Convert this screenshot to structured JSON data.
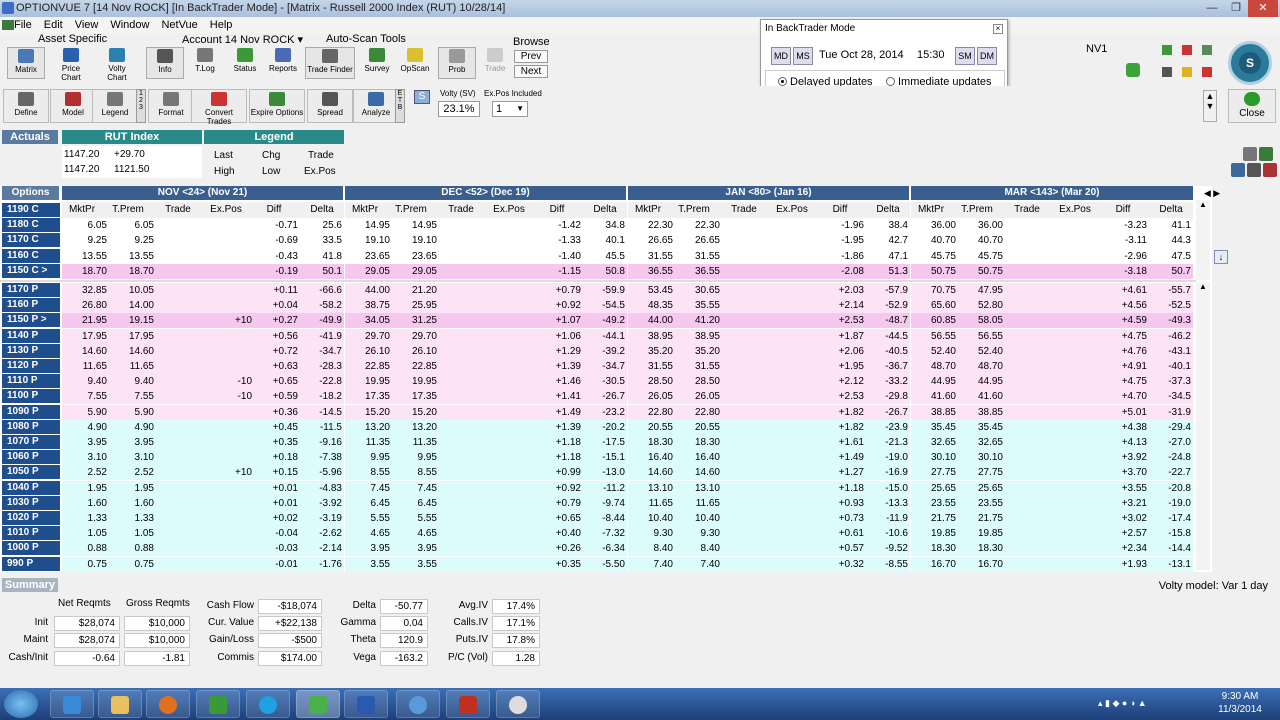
{
  "titlebar": {
    "title": "OPTIONVUE 7   [14 Nov ROCK]   [In BackTrader Mode]  - [Matrix  - Russell 2000 Index (RUT)  10/28/14]",
    "minimize": "—",
    "restore": "❐",
    "close": "✕"
  },
  "menu": [
    "File",
    "Edit",
    "View",
    "Window",
    "NetVue",
    "Help"
  ],
  "ribbon1": {
    "groups": {
      "asset": "Asset Specific",
      "account": "Account 14 Nov ROCK ▾",
      "autoscan": "Auto-Scan Tools",
      "browse": "Browse"
    },
    "buttons": [
      {
        "label": "Matrix",
        "icon": "matrix-icon"
      },
      {
        "label": "Price Chart",
        "icon": "price-chart-icon"
      },
      {
        "label": "Volty Chart",
        "icon": "volty-chart-icon"
      },
      {
        "label": "Info",
        "icon": "info-icon"
      },
      {
        "label": "T.Log",
        "icon": "tlog-icon"
      },
      {
        "label": "Status",
        "icon": "status-icon"
      },
      {
        "label": "Reports",
        "icon": "reports-icon"
      },
      {
        "label": "Trade Finder",
        "icon": "trade-finder-icon"
      },
      {
        "label": "Survey",
        "icon": "survey-icon"
      },
      {
        "label": "OpScan",
        "icon": "opscan-icon"
      },
      {
        "label": "Prob",
        "icon": "prob-icon"
      },
      {
        "label": "Trade",
        "icon": "trade-icon"
      }
    ],
    "prev": "Prev",
    "next": "Next",
    "nv": "NV1"
  },
  "backtrader": {
    "title": "In BackTrader Mode",
    "date": "Tue Oct 28, 2014",
    "time": "15:30",
    "btn_md": "MD",
    "btn_ms": "MS",
    "btn_sm": "SM",
    "btn_dm": "DM",
    "delayed": "Delayed updates",
    "immediate": "Immediate updates"
  },
  "ribbon2": {
    "buttons": [
      "Define",
      "Model",
      "Legend",
      "Format",
      "Convert Trades",
      "Expire Options",
      "Spread",
      "Analyze"
    ],
    "s_btn": "S",
    "volty_label": "Volty (SV)",
    "volty_value": "23.1%",
    "expos_label": "Ex.Pos Included",
    "expos_value": "1",
    "close": "Close"
  },
  "actuals": {
    "label": "Actuals",
    "index_title": "RUT Index",
    "last": "1147.20",
    "chg": "+29.70",
    "high": "1147.20",
    "low": "1121.50",
    "legend_title": "Legend",
    "legend": [
      "Last",
      "Chg",
      "Trade",
      "High",
      "Low",
      "Ex.Pos"
    ]
  },
  "options": {
    "label": "Options",
    "months": [
      "NOV <24> (Nov 21)",
      "DEC <52> (Dec 19)",
      "JAN <80> (Jan 16)",
      "MAR <143> (Mar 20)"
    ],
    "cols": [
      "MktPr",
      "T.Prem",
      "Trade",
      "Ex.Pos",
      "Diff",
      "Delta"
    ],
    "calls": [
      {
        "s": "1190 C",
        "c": "",
        "m": [
          [
            "",
            "",
            "",
            "",
            "",
            ""
          ],
          [
            "",
            "",
            "",
            "",
            "",
            ""
          ],
          [
            "",
            "",
            "",
            "",
            "",
            ""
          ],
          [
            "",
            "",
            "",
            "",
            "",
            ""
          ]
        ]
      },
      {
        "s": "1180 C",
        "c": "",
        "m": [
          [
            "6.05",
            "6.05",
            "",
            "",
            "-0.71",
            "25.6"
          ],
          [
            "14.95",
            "14.95",
            "",
            "",
            "-1.42",
            "34.8"
          ],
          [
            "22.30",
            "22.30",
            "",
            "",
            "-1.96",
            "38.4"
          ],
          [
            "36.00",
            "36.00",
            "",
            "",
            "-3.23",
            "41.1"
          ]
        ]
      },
      {
        "s": "1170 C",
        "c": "",
        "m": [
          [
            "9.25",
            "9.25",
            "",
            "",
            "-0.69",
            "33.5"
          ],
          [
            "19.10",
            "19.10",
            "",
            "",
            "-1.33",
            "40.1"
          ],
          [
            "26.65",
            "26.65",
            "",
            "",
            "-1.95",
            "42.7"
          ],
          [
            "40.70",
            "40.70",
            "",
            "",
            "-3.11",
            "44.3"
          ]
        ]
      },
      {
        "s": "1160 C",
        "c": "",
        "m": [
          [
            "13.55",
            "13.55",
            "",
            "",
            "-0.43",
            "41.8"
          ],
          [
            "23.65",
            "23.65",
            "",
            "",
            "-1.40",
            "45.5"
          ],
          [
            "31.55",
            "31.55",
            "",
            "",
            "-1.86",
            "47.1"
          ],
          [
            "45.75",
            "45.75",
            "",
            "",
            "-2.96",
            "47.5"
          ]
        ]
      },
      {
        "s": "1150 C >",
        "c": "hl",
        "m": [
          [
            "18.70",
            "18.70",
            "",
            "",
            "-0.19",
            "50.1"
          ],
          [
            "29.05",
            "29.05",
            "",
            "",
            "-1.15",
            "50.8"
          ],
          [
            "36.55",
            "36.55",
            "",
            "",
            "-2.08",
            "51.3"
          ],
          [
            "50.75",
            "50.75",
            "",
            "",
            "-3.18",
            "50.7"
          ]
        ]
      }
    ],
    "puts": [
      {
        "s": "1170 P",
        "c": "pink",
        "m": [
          [
            "32.85",
            "10.05",
            "",
            "",
            "+0.11",
            "-66.6"
          ],
          [
            "44.00",
            "21.20",
            "",
            "",
            "+0.79",
            "-59.9"
          ],
          [
            "53.45",
            "30.65",
            "",
            "",
            "+2.03",
            "-57.9"
          ],
          [
            "70.75",
            "47.95",
            "",
            "",
            "+4.61",
            "-55.7"
          ]
        ]
      },
      {
        "s": "1160 P",
        "c": "pink",
        "m": [
          [
            "26.80",
            "14.00",
            "",
            "",
            "+0.04",
            "-58.2"
          ],
          [
            "38.75",
            "25.95",
            "",
            "",
            "+0.92",
            "-54.5"
          ],
          [
            "48.35",
            "35.55",
            "",
            "",
            "+2.14",
            "-52.9"
          ],
          [
            "65.60",
            "52.80",
            "",
            "",
            "+4.56",
            "-52.5"
          ]
        ]
      },
      {
        "s": "1150 P >",
        "c": "hl",
        "m": [
          [
            "21.95",
            "19.15",
            "",
            "+10",
            "+0.27",
            "-49.9"
          ],
          [
            "34.05",
            "31.25",
            "",
            "",
            "+1.07",
            "-49.2"
          ],
          [
            "44.00",
            "41.20",
            "",
            "",
            "+2.53",
            "-48.7"
          ],
          [
            "60.85",
            "58.05",
            "",
            "",
            "+4.59",
            "-49.3"
          ]
        ]
      },
      {
        "s": "1140 P",
        "c": "pink",
        "m": [
          [
            "17.95",
            "17.95",
            "",
            "",
            "+0.56",
            "-41.9"
          ],
          [
            "29.70",
            "29.70",
            "",
            "",
            "+1.06",
            "-44.1"
          ],
          [
            "38.95",
            "38.95",
            "",
            "",
            "+1.87",
            "-44.5"
          ],
          [
            "56.55",
            "56.55",
            "",
            "",
            "+4.75",
            "-46.2"
          ]
        ]
      },
      {
        "s": "1130 P",
        "c": "pink",
        "m": [
          [
            "14.60",
            "14.60",
            "",
            "",
            "+0.72",
            "-34.7"
          ],
          [
            "26.10",
            "26.10",
            "",
            "",
            "+1.29",
            "-39.2"
          ],
          [
            "35.20",
            "35.20",
            "",
            "",
            "+2.06",
            "-40.5"
          ],
          [
            "52.40",
            "52.40",
            "",
            "",
            "+4.76",
            "-43.1"
          ]
        ]
      },
      {
        "s": "1120 P",
        "c": "pink",
        "m": [
          [
            "11.65",
            "11.65",
            "",
            "",
            "+0.63",
            "-28.3"
          ],
          [
            "22.85",
            "22.85",
            "",
            "",
            "+1.39",
            "-34.7"
          ],
          [
            "31.55",
            "31.55",
            "",
            "",
            "+1.95",
            "-36.7"
          ],
          [
            "48.70",
            "48.70",
            "",
            "",
            "+4.91",
            "-40.1"
          ]
        ]
      },
      {
        "s": "1110 P",
        "c": "pink",
        "m": [
          [
            "9.40",
            "9.40",
            "",
            "-10",
            "+0.65",
            "-22.8"
          ],
          [
            "19.95",
            "19.95",
            "",
            "",
            "+1.46",
            "-30.5"
          ],
          [
            "28.50",
            "28.50",
            "",
            "",
            "+2.12",
            "-33.2"
          ],
          [
            "44.95",
            "44.95",
            "",
            "",
            "+4.75",
            "-37.3"
          ]
        ]
      },
      {
        "s": "1100 P",
        "c": "pink",
        "m": [
          [
            "7.55",
            "7.55",
            "",
            "-10",
            "+0.59",
            "-18.2"
          ],
          [
            "17.35",
            "17.35",
            "",
            "",
            "+1.41",
            "-26.7"
          ],
          [
            "26.05",
            "26.05",
            "",
            "",
            "+2.53",
            "-29.8"
          ],
          [
            "41.60",
            "41.60",
            "",
            "",
            "+4.70",
            "-34.5"
          ]
        ]
      },
      {
        "s": "1090 P",
        "c": "pink",
        "m": [
          [
            "5.90",
            "5.90",
            "",
            "",
            "+0.36",
            "-14.5"
          ],
          [
            "15.20",
            "15.20",
            "",
            "",
            "+1.49",
            "-23.2"
          ],
          [
            "22.80",
            "22.80",
            "",
            "",
            "+1.82",
            "-26.7"
          ],
          [
            "38.85",
            "38.85",
            "",
            "",
            "+5.01",
            "-31.9"
          ]
        ]
      },
      {
        "s": "1080 P",
        "c": "cyan",
        "m": [
          [
            "4.90",
            "4.90",
            "",
            "",
            "+0.45",
            "-11.5"
          ],
          [
            "13.20",
            "13.20",
            "",
            "",
            "+1.39",
            "-20.2"
          ],
          [
            "20.55",
            "20.55",
            "",
            "",
            "+1.82",
            "-23.9"
          ],
          [
            "35.45",
            "35.45",
            "",
            "",
            "+4.38",
            "-29.4"
          ]
        ]
      },
      {
        "s": "1070 P",
        "c": "cyan",
        "m": [
          [
            "3.95",
            "3.95",
            "",
            "",
            "+0.35",
            "-9.16"
          ],
          [
            "11.35",
            "11.35",
            "",
            "",
            "+1.18",
            "-17.5"
          ],
          [
            "18.30",
            "18.30",
            "",
            "",
            "+1.61",
            "-21.3"
          ],
          [
            "32.65",
            "32.65",
            "",
            "",
            "+4.13",
            "-27.0"
          ]
        ]
      },
      {
        "s": "1060 P",
        "c": "cyan",
        "m": [
          [
            "3.10",
            "3.10",
            "",
            "",
            "+0.18",
            "-7.38"
          ],
          [
            "9.95",
            "9.95",
            "",
            "",
            "+1.18",
            "-15.1"
          ],
          [
            "16.40",
            "16.40",
            "",
            "",
            "+1.49",
            "-19.0"
          ],
          [
            "30.10",
            "30.10",
            "",
            "",
            "+3.92",
            "-24.8"
          ]
        ]
      },
      {
        "s": "1050 P",
        "c": "cyan",
        "m": [
          [
            "2.52",
            "2.52",
            "",
            "+10",
            "+0.15",
            "-5.96"
          ],
          [
            "8.55",
            "8.55",
            "",
            "",
            "+0.99",
            "-13.0"
          ],
          [
            "14.60",
            "14.60",
            "",
            "",
            "+1.27",
            "-16.9"
          ],
          [
            "27.75",
            "27.75",
            "",
            "",
            "+3.70",
            "-22.7"
          ]
        ]
      },
      {
        "s": "1040 P",
        "c": "cyan",
        "m": [
          [
            "1.95",
            "1.95",
            "",
            "",
            "+0.01",
            "-4.83"
          ],
          [
            "7.45",
            "7.45",
            "",
            "",
            "+0.92",
            "-11.2"
          ],
          [
            "13.10",
            "13.10",
            "",
            "",
            "+1.18",
            "-15.0"
          ],
          [
            "25.65",
            "25.65",
            "",
            "",
            "+3.55",
            "-20.8"
          ]
        ]
      },
      {
        "s": "1030 P",
        "c": "cyan",
        "m": [
          [
            "1.60",
            "1.60",
            "",
            "",
            "+0.01",
            "-3.92"
          ],
          [
            "6.45",
            "6.45",
            "",
            "",
            "+0.79",
            "-9.74"
          ],
          [
            "11.65",
            "11.65",
            "",
            "",
            "+0.93",
            "-13.3"
          ],
          [
            "23.55",
            "23.55",
            "",
            "",
            "+3.21",
            "-19.0"
          ]
        ]
      },
      {
        "s": "1020 P",
        "c": "cyan",
        "m": [
          [
            "1.33",
            "1.33",
            "",
            "",
            "+0.02",
            "-3.19"
          ],
          [
            "5.55",
            "5.55",
            "",
            "",
            "+0.65",
            "-8.44"
          ],
          [
            "10.40",
            "10.40",
            "",
            "",
            "+0.73",
            "-11.9"
          ],
          [
            "21.75",
            "21.75",
            "",
            "",
            "+3.02",
            "-17.4"
          ]
        ]
      },
      {
        "s": "1010 P",
        "c": "cyan",
        "m": [
          [
            "1.05",
            "1.05",
            "",
            "",
            "-0.04",
            "-2.62"
          ],
          [
            "4.65",
            "4.65",
            "",
            "",
            "+0.40",
            "-7.32"
          ],
          [
            "9.30",
            "9.30",
            "",
            "",
            "+0.61",
            "-10.6"
          ],
          [
            "19.85",
            "19.85",
            "",
            "",
            "+2.57",
            "-15.8"
          ]
        ]
      },
      {
        "s": "1000 P",
        "c": "cyan",
        "m": [
          [
            "0.88",
            "0.88",
            "",
            "",
            "-0.03",
            "-2.14"
          ],
          [
            "3.95",
            "3.95",
            "",
            "",
            "+0.26",
            "-6.34"
          ],
          [
            "8.40",
            "8.40",
            "",
            "",
            "+0.57",
            "-9.52"
          ],
          [
            "18.30",
            "18.30",
            "",
            "",
            "+2.34",
            "-14.4"
          ]
        ]
      },
      {
        "s": "990 P",
        "c": "cyan",
        "m": [
          [
            "0.75",
            "0.75",
            "",
            "",
            "-0.01",
            "-1.76"
          ],
          [
            "3.55",
            "3.55",
            "",
            "",
            "+0.35",
            "-5.50"
          ],
          [
            "7.40",
            "7.40",
            "",
            "",
            "+0.32",
            "-8.55"
          ],
          [
            "16.70",
            "16.70",
            "",
            "",
            "+1.93",
            "-13.1"
          ]
        ]
      }
    ]
  },
  "summary": {
    "label": "Summary",
    "volty_model": "Volty model: Var 1 day",
    "net_reqmts": "Net Reqmts",
    "gross_reqmts": "Gross Reqmts",
    "init_label": "Init",
    "init_net": "$28,074",
    "init_gross": "$10,000",
    "maint_label": "Maint",
    "maint_net": "$28,074",
    "maint_gross": "$10,000",
    "cashinit_label": "Cash/Init",
    "cashinit_net": "-0.64",
    "cashinit_gross": "-1.81",
    "cashflow_label": "Cash Flow",
    "cashflow": "-$18,074",
    "curvalue_label": "Cur. Value",
    "curvalue": "+$22,138",
    "gainloss_label": "Gain/Loss",
    "gainloss": "-$500",
    "commis_label": "Commis",
    "commis": "$174.00",
    "delta_label": "Delta",
    "delta": "-50.77",
    "gamma_label": "Gamma",
    "gamma": "0.04",
    "theta_label": "Theta",
    "theta": "120.9",
    "vega_label": "Vega",
    "vega": "-163.2",
    "avgiv_label": "Avg.IV",
    "avgiv": "17.4%",
    "callsiv_label": "Calls.IV",
    "callsiv": "17.1%",
    "putsiv_label": "Puts.IV",
    "putsiv": "17.8%",
    "pcvol_label": "P/C (Vol)",
    "pcvol": "1.28"
  },
  "taskbar": {
    "time": "9:30 AM",
    "date": "11/3/2014"
  },
  "colors": {
    "strike_bg": "#1f4e8c",
    "header_bg": "#3a5f8f",
    "pink": "#fde3f6",
    "cyan": "#dcfbfb",
    "highlight": "#f6c8f0"
  }
}
